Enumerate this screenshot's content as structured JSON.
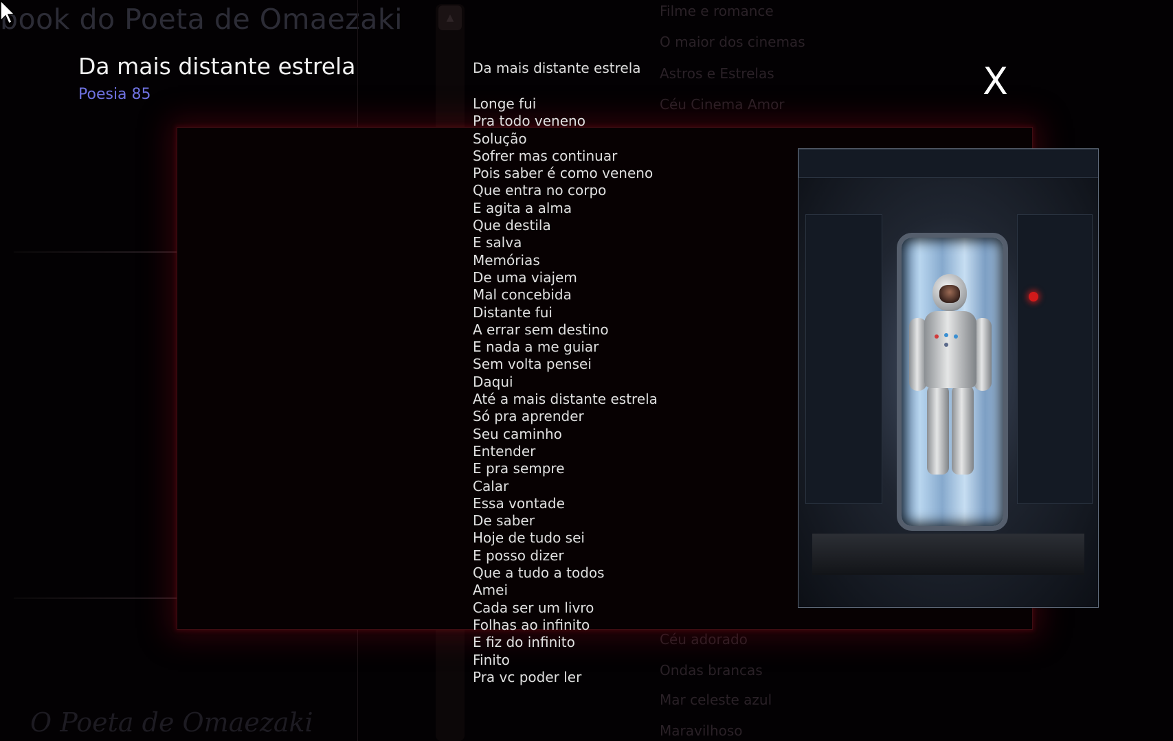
{
  "background": {
    "title": "book do Poeta de Omaezaki",
    "footer": "O Poeta de Omaezaki",
    "scroll_up_symbol": "▲",
    "menu_top": [
      "Filme e romance",
      "O maior dos cinemas",
      "Astros e Estrelas",
      "Céu Cinema Amor"
    ],
    "menu_bottom": [
      "Céu adorado",
      "Ondas brancas",
      "Mar celeste azul",
      "Maravilhoso"
    ]
  },
  "overlay": {
    "heading": "Da mais distante estrela",
    "number": "Poesia 85",
    "close_label": "X"
  },
  "poem": {
    "title": "Da mais distante estrela",
    "lines": [
      "Longe fui",
      "Pra todo veneno",
      "Solução",
      "Sofrer mas continuar",
      "Pois saber é como veneno",
      "Que entra no corpo",
      "E agita a alma",
      "Que destila",
      "E salva",
      "Memórias",
      "De uma viajem",
      "Mal concebida",
      "Distante fui",
      "A errar sem destino",
      "E nada a me guiar",
      "Sem volta pensei",
      "Daqui",
      "Até a mais distante estrela",
      "Só pra aprender",
      "Seu caminho",
      "Entender",
      "E pra sempre",
      "Calar",
      "Essa vontade",
      "De saber",
      "Hoje de tudo sei",
      "E posso dizer",
      "Que a tudo a todos",
      "Amei",
      "Cada ser um livro",
      "Folhas ao infinito",
      "E fiz do infinito",
      "Finito",
      "Pra vc poder ler"
    ]
  },
  "colors": {
    "heading": "#f2f2f2",
    "number_accent": "#6f72e0",
    "glow": "#780a14",
    "background": "#030103"
  },
  "icons": {
    "cursor": "arrow-cursor-icon",
    "close": "close-icon",
    "scroll_up": "scroll-up-icon"
  }
}
